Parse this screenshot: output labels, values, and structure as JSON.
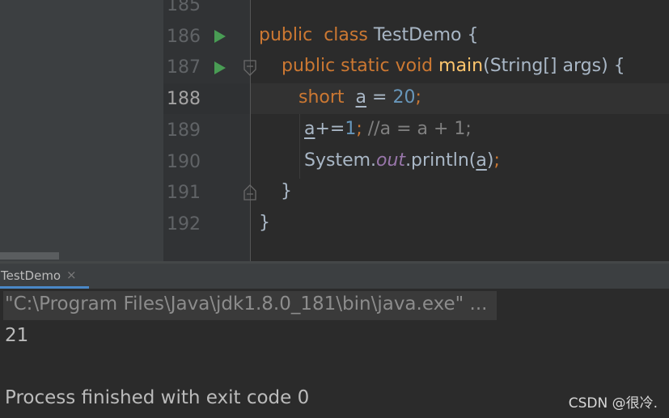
{
  "editor": {
    "line_numbers": [
      "185",
      "186",
      "187",
      "188",
      "189",
      "190",
      "191",
      "192"
    ],
    "code": {
      "l186": {
        "kw1": "public",
        "kw2": "class",
        "name": "TestDemo {"
      },
      "l187": {
        "kw": "public static void",
        "method": "main",
        "params": "(String[] args) {"
      },
      "l188": {
        "kw": "short",
        "var": "a",
        "op": " = ",
        "num": "20",
        "semi": ";"
      },
      "l189": {
        "var": "a",
        "op": "+=",
        "num": "1",
        "semi": ";",
        "comment": " //a = a + 1;"
      },
      "l190": {
        "cls": "System.",
        "field": "out",
        "call": ".println(",
        "var": "a",
        "close": ")",
        "semi": ";"
      },
      "l191": {
        "brace": "}"
      },
      "l192": {
        "brace": "}"
      }
    }
  },
  "run_panel": {
    "tab_label": "TestDemo",
    "tab_close": "×",
    "console_lines": {
      "command": "\"C:\\Program Files\\Java\\jdk1.8.0_181\\bin\\java.exe\" ...",
      "output": "21",
      "exit": "Process finished with exit code 0"
    }
  },
  "watermark": "CSDN @很冷.",
  "colors": {
    "background": "#2b2b2b",
    "keyword": "#cc7832",
    "method": "#ffc66d",
    "number": "#6897bb",
    "comment": "#808080",
    "run_icon": "#499c54"
  }
}
